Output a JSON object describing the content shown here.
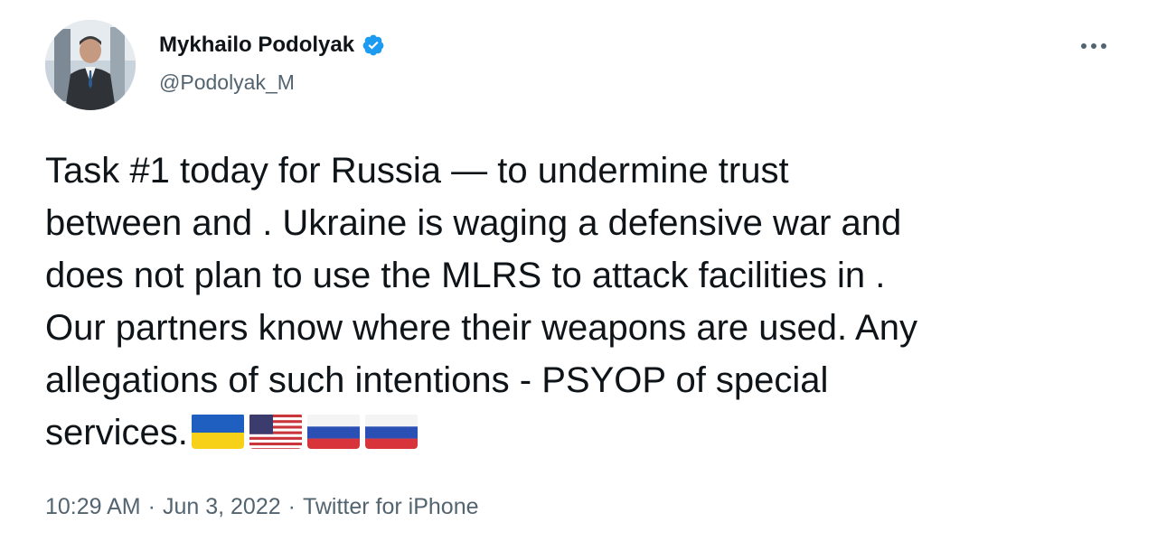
{
  "author": {
    "display_name": "Mykhailo Podolyak",
    "handle": "@Podolyak_M",
    "verified": true,
    "verified_color": "#1d9bf0"
  },
  "tweet": {
    "lines": [
      "Task #1 today for Russia — to undermine trust",
      "between  and . Ukraine is waging a defensive war and",
      "does not plan to use the MLRS to attack facilities in .",
      "Our partners know where their weapons are used. Any",
      "allegations of such intentions - PSYOP of  special",
      "services."
    ],
    "flags": [
      "ukraine-flag",
      "usa-flag",
      "russia-flag",
      "russia-flag"
    ]
  },
  "meta": {
    "time": "10:29 AM",
    "separator": "·",
    "date": "Jun 3, 2022",
    "source": "Twitter for iPhone"
  },
  "icons": {
    "more": "more-horizontal-icon",
    "verified": "verified-badge-icon"
  }
}
